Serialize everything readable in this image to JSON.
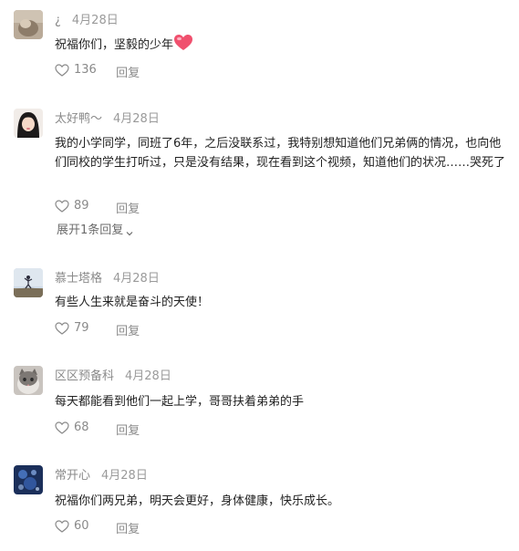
{
  "comments": [
    {
      "user": "¿",
      "date": "4月28日",
      "text": "祝福你们，坚毅的少年",
      "likes": "136",
      "reply_label": "回复",
      "emoji": "heart-emoji"
    },
    {
      "user": "太好鸭～",
      "date": "4月28日",
      "text": "我的小学同学，同班了6年，之后没联系过，我特别想知道他们兄弟俩的情况，也向他们同校的学生打听过，只是没有结果，现在看到这个视频，知道他们的状况……哭死了",
      "likes": "89",
      "reply_label": "回复",
      "expand_label": "展开1条回复"
    },
    {
      "user": "慕士塔格",
      "date": "4月28日",
      "text": "有些人生来就是奋斗的天使！",
      "likes": "79",
      "reply_label": "回复"
    },
    {
      "user": "区区预备科",
      "date": "4月28日",
      "text": "每天都能看到他们一起上学，哥哥扶着弟弟的手",
      "likes": "68",
      "reply_label": "回复"
    },
    {
      "user": "常开心",
      "date": "4月28日",
      "text": "祝福你们两兄弟，明天会更好，身体健康，快乐成长。",
      "likes": "60",
      "reply_label": "回复"
    }
  ],
  "icons": {
    "like": "heart-outline-icon",
    "expand": "chevron-down-icon"
  },
  "colors": {
    "text": "#222222",
    "meta": "#8a8a8a",
    "emoji_heart": "#f0506e"
  }
}
